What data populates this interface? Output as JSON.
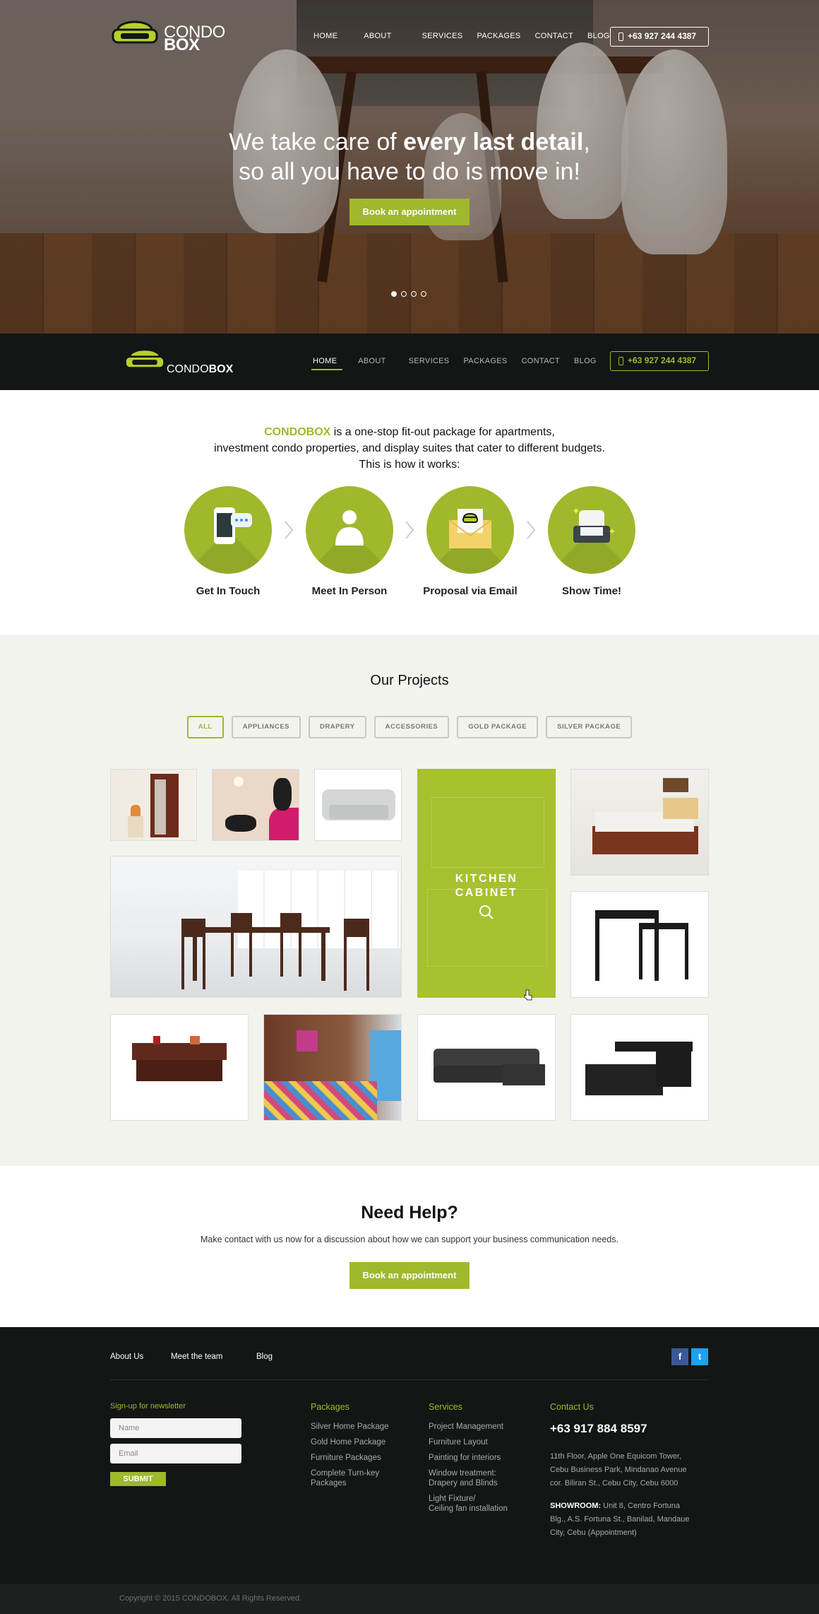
{
  "brand": {
    "logo_top": "CONDO",
    "logo_bottom": "BOX",
    "accent": "#9fb82c",
    "dark": "#121615"
  },
  "nav": {
    "items": [
      "HOME",
      "ABOUT",
      "SERVICES",
      "PACKAGES",
      "CONTACT",
      "BLOG"
    ],
    "active": "HOME",
    "phone": "+63 927 244 4387"
  },
  "hero": {
    "line1_a": "We take care of ",
    "line1_b": "every last detail",
    "line1_c": ",",
    "line2": "so all you have to do is move in!",
    "cta": "Book an appointment",
    "slide_count": 4,
    "active_slide": 1
  },
  "intro": {
    "brand_name": "CONDOBOX",
    "text1": " is a one-stop fit-out package for apartments,",
    "text2": "investment condo properties, and display suites that cater to different budgets.",
    "text3": "This is how it works:",
    "steps": [
      {
        "label": "Get In Touch",
        "icon": "phone-chat-icon"
      },
      {
        "label": "Meet In Person",
        "icon": "person-icon"
      },
      {
        "label": "Proposal via Email",
        "icon": "email-icon"
      },
      {
        "label": "Show Time!",
        "icon": "sofa-icon"
      }
    ]
  },
  "projects": {
    "title": "Our Projects",
    "filters": [
      "ALL",
      "APPLIANCES",
      "DRAPERY",
      "ACCESSORIES",
      "GOLD PACKAGE",
      "SILVER PACKAGE"
    ],
    "active_filter": "ALL",
    "hover_tile_line1": "KITCHEN",
    "hover_tile_line2": "CABINET"
  },
  "help": {
    "title": "Need Help?",
    "text": "Make contact with us now for a discussion about how we can support your business communication needs.",
    "cta": "Book an appointment"
  },
  "footer": {
    "top_links": [
      "About Us",
      "Meet the team",
      "Blog"
    ],
    "social": [
      "f",
      "t"
    ],
    "newsletter": {
      "heading": "Sign-up for newsletter",
      "name_placeholder": "Name",
      "email_placeholder": "Email",
      "submit": "SUBMIT"
    },
    "packages": {
      "heading": "Packages",
      "items": [
        "Silver Home Package",
        "Gold Home Package",
        "Furniture Packages",
        "Complete Turn-key",
        "Packages"
      ]
    },
    "services": {
      "heading": "Services",
      "items": [
        "Project Management",
        "Furniture Layout",
        "Painting for interiors",
        "Window treatment:",
        "Drapery and Blinds",
        "Light Fixture/",
        "Ceiling fan installation"
      ]
    },
    "contact": {
      "heading": "Contact Us",
      "phone": "+63 917 884 8597",
      "address1": "11th Floor, Apple One Equicom Tower,",
      "address2": "Cebu Business Park, Mindanao Avenue",
      "address3": "cor. Biliran St., Cebu City, Cebu 6000",
      "showroom_label": "SHOWROOM:",
      "showroom1": " Unit 8, Centro Fortuna",
      "showroom2": "Blg., A.S. Fortuna St., Banilad, Mandaue",
      "showroom3": "City, Cebu (Appointment)"
    },
    "copyright": "Copyright © 2015 CONDOBOX. All Rights Reserved."
  }
}
